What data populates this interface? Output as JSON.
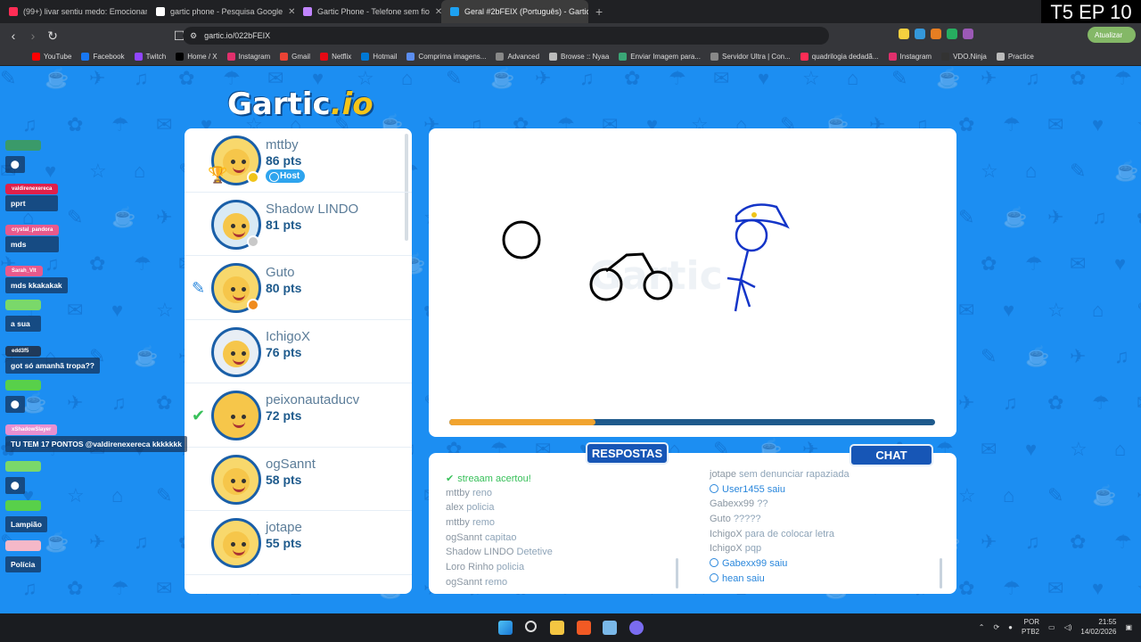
{
  "tabs": [
    {
      "title": "(99+) livar sentiu medo: Emocionante",
      "active": false
    },
    {
      "title": "gartic phone - Pesquisa Google",
      "active": false
    },
    {
      "title": "Gartic Phone - Telefone sem fio",
      "active": false
    },
    {
      "title": "Geral #2bFEIX (Português) - Gartic",
      "active": true
    }
  ],
  "episode_label": "T5 EP 10",
  "url": "gartic.io/022bFEIX",
  "update_button": "Atualizar",
  "bookmarks": [
    "YouTube",
    "Facebook",
    "Twitch",
    "Home / X",
    "Instagram",
    "Gmail",
    "Netflix",
    "Hotmail",
    "Comprima imagens...",
    "Advanced",
    "Browse :: Nyaa",
    "Enviar Imagem para...",
    "Servidor Ultra | Con...",
    "quadrilogia dedadã...",
    "Instagram",
    "VDO.Ninja",
    "Practice"
  ],
  "logo": {
    "main": "Gartic",
    "suffix": ".io"
  },
  "players": [
    {
      "name": "mttby",
      "points": "86 pts",
      "host": "Host",
      "dot": "#f0c419",
      "mark": "trophy"
    },
    {
      "name": "Shadow LINDO",
      "points": "81 pts",
      "dot": "#c8c8c8",
      "mark": ""
    },
    {
      "name": "Guto",
      "points": "80 pts",
      "dot": "#ef8a1c",
      "mark": "pencil"
    },
    {
      "name": "IchigoX",
      "points": "76 pts",
      "dot": "",
      "mark": ""
    },
    {
      "name": "peixonautaducv",
      "points": "72 pts",
      "dot": "",
      "mark": "check"
    },
    {
      "name": "ogSannt",
      "points": "58 pts",
      "dot": "",
      "mark": ""
    },
    {
      "name": "jotape",
      "points": "55 pts",
      "dot": "",
      "mark": ""
    }
  ],
  "timer_progress": 0.3,
  "panels": {
    "answers_title": "RESPOSTAS",
    "chat_title": "CHAT"
  },
  "answers": [
    {
      "user": "streaam",
      "text": "acertou!",
      "type": "correct"
    },
    {
      "user": "mttby",
      "text": "reno",
      "type": "normal"
    },
    {
      "user": "alex",
      "text": "policia",
      "type": "normal"
    },
    {
      "user": "mttby",
      "text": "remo",
      "type": "normal"
    },
    {
      "user": "ogSannt",
      "text": "capitao",
      "type": "normal"
    },
    {
      "user": "Shadow LINDO",
      "text": "Detetive",
      "type": "normal"
    },
    {
      "user": "Loro Rinho",
      "text": "policia",
      "type": "normal"
    },
    {
      "user": "ogSannt",
      "text": "remo",
      "type": "normal"
    }
  ],
  "chat": [
    {
      "user": "jotape",
      "text": "sem denunciar rapaziada",
      "type": "normal"
    },
    {
      "user": "User1455",
      "text": "saiu",
      "type": "info"
    },
    {
      "user": "Gabexx99",
      "text": "??",
      "type": "normal"
    },
    {
      "user": "Guto",
      "text": "?????",
      "type": "normal"
    },
    {
      "user": "IchigoX",
      "text": "para de colocar letra",
      "type": "normal"
    },
    {
      "user": "IchigoX",
      "text": "pqp",
      "type": "normal"
    },
    {
      "user": "Gabexx99",
      "text": "saiu",
      "type": "info"
    },
    {
      "user": "hean",
      "text": "saiu",
      "type": "info"
    }
  ],
  "stream_chat": [
    {
      "user": "",
      "text": "",
      "color": "#3a9a6a"
    },
    {
      "user": "valdirenexereca",
      "text": "pprt",
      "color": "#e0204a"
    },
    {
      "user": "crystal_pandora",
      "text": "mds",
      "color": "#e85a8c"
    },
    {
      "user": "Sarah_Vlt",
      "text": "mds kkakakak",
      "color": "#e85a8c"
    },
    {
      "user": "",
      "text": "a sua",
      "color": "#7ad86a"
    },
    {
      "user": "edd3f5",
      "text": "got só amanhã tropa??",
      "color": "#203a5a"
    },
    {
      "user": "",
      "text": "",
      "color": "#58d04a"
    },
    {
      "user": "xShadowSlayer",
      "text": "TU TEM 17 PONTOS @valdirenexereca kkkkkkk",
      "color": "#e890d0"
    },
    {
      "user": "",
      "text": "",
      "color": "#7ad86a"
    },
    {
      "user": "",
      "text": "Lampião",
      "color": "#58d04a"
    },
    {
      "user": "",
      "text": "Polícia",
      "color": "#f5b8c8"
    }
  ],
  "tray": {
    "lang": "POR",
    "layout": "PTB2",
    "time": "21:55",
    "date": "14/02/2026"
  }
}
